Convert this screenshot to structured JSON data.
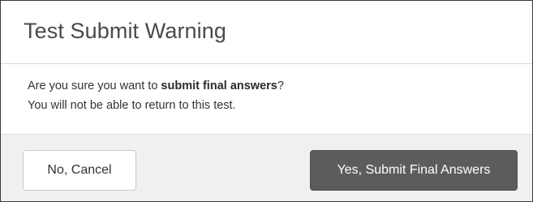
{
  "dialog": {
    "title": "Test Submit Warning",
    "message": {
      "line1_prefix": "Are you sure you want to ",
      "line1_bold": "submit final answers",
      "line1_suffix": "?",
      "line2": "You will not be able to return to this test."
    },
    "buttons": {
      "cancel_label": "No, Cancel",
      "submit_label": "Yes, Submit Final Answers"
    }
  }
}
